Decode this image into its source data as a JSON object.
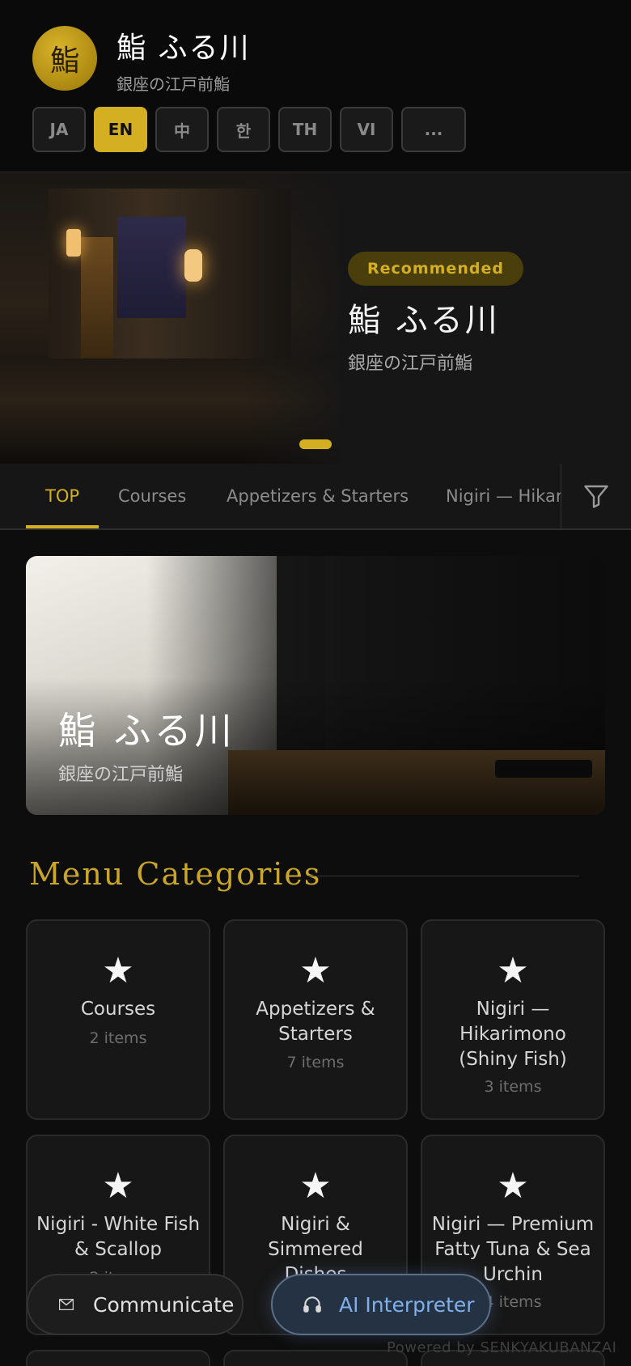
{
  "header": {
    "logo_char": "鮨",
    "title": "鮨 ふる川",
    "subtitle": "銀座の江戸前鮨",
    "languages": [
      {
        "code": "JA",
        "active": false
      },
      {
        "code": "EN",
        "active": true
      },
      {
        "code": "中",
        "active": false
      },
      {
        "code": "한",
        "active": false
      },
      {
        "code": "TH",
        "active": false
      },
      {
        "code": "VI",
        "active": false
      },
      {
        "code": "...",
        "active": false
      }
    ]
  },
  "hero": {
    "badge": "Recommended",
    "title": "鮨 ふる川",
    "subtitle": "銀座の江戸前鮨"
  },
  "tabs": [
    {
      "label": "TOP",
      "active": true
    },
    {
      "label": "Courses",
      "active": false
    },
    {
      "label": "Appetizers & Starters",
      "active": false
    },
    {
      "label": "Nigiri — Hikari",
      "active": false
    }
  ],
  "filter_icon": "filter-icon",
  "banner": {
    "title": "鮨 ふる川",
    "subtitle": "銀座の江戸前鮨"
  },
  "menu": {
    "section_title": "Menu Categories",
    "categories": [
      {
        "icon": "★",
        "name": "Courses",
        "count": "2 items"
      },
      {
        "icon": "★",
        "name": "Appetizers & Starters",
        "count": "7 items"
      },
      {
        "icon": "★",
        "name": "Nigiri — Hikarimono (Shiny Fish)",
        "count": "3 items"
      },
      {
        "icon": "★",
        "name": "Nigiri - White Fish & Scallop",
        "count": "2 items"
      },
      {
        "icon": "★",
        "name": "Nigiri & Simmered Dishes",
        "count": ""
      },
      {
        "icon": "★",
        "name": "Nigiri — Premium Fatty Tuna & Sea Urchin",
        "count": "4 items"
      }
    ]
  },
  "footer": {
    "powered_by": "Powered by SENKYAKUBANZAI"
  },
  "fabs": {
    "communicate": "Communicate",
    "interpreter": "AI Interpreter"
  },
  "colors": {
    "accent": "#d4af21",
    "background": "#0d0d0d",
    "interpreter": "#7fb0ea"
  }
}
